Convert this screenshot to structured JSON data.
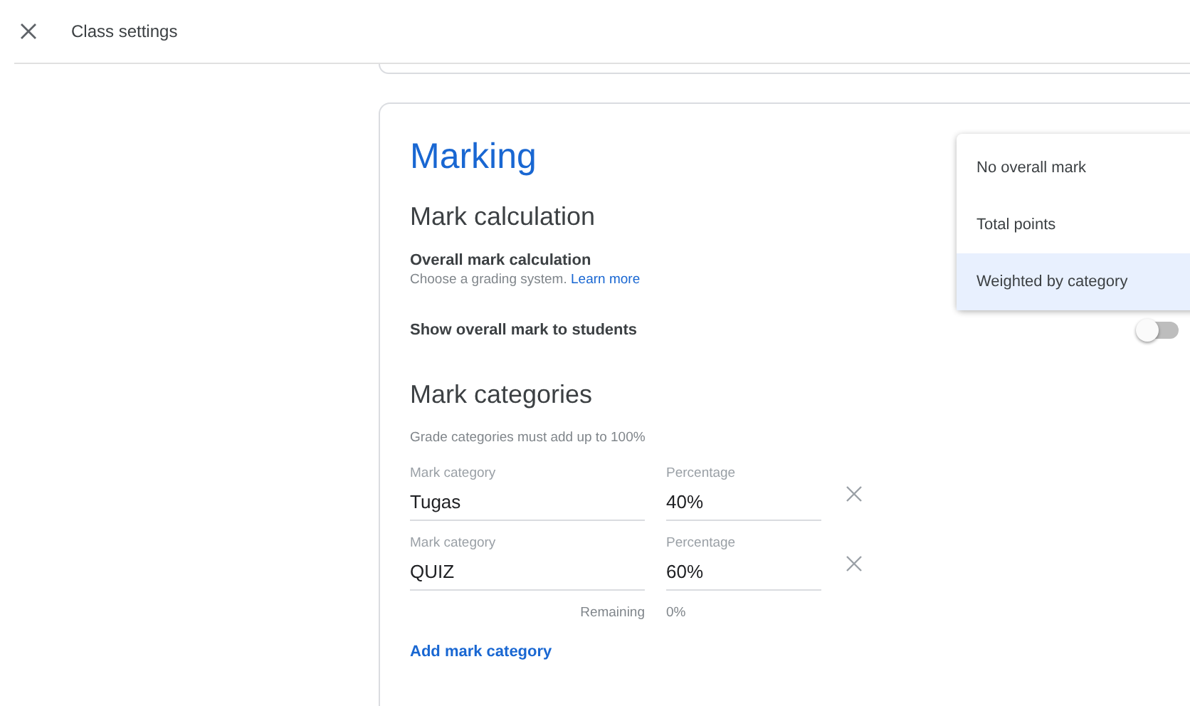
{
  "header": {
    "title": "Class settings"
  },
  "section": {
    "title": "Marking",
    "calculation": {
      "heading": "Mark calculation",
      "label": "Overall mark calculation",
      "hint": "Choose a grading system.",
      "link": "Learn more"
    },
    "show_to_students": {
      "label": "Show overall mark to students",
      "on": false
    },
    "categories": {
      "heading": "Mark categories",
      "hint": "Grade categories must add up to 100%",
      "rows": [
        {
          "name_label": "Mark category",
          "name": "Tugas",
          "percent_label": "Percentage",
          "percent": "40%"
        },
        {
          "name_label": "Mark category",
          "name": "QUIZ",
          "percent_label": "Percentage",
          "percent": "60%"
        }
      ],
      "remaining_label": "Remaining",
      "remaining": "0%",
      "add": "Add mark category"
    }
  },
  "dropdown": {
    "options": [
      {
        "label": "No overall mark",
        "selected": false
      },
      {
        "label": "Total points",
        "selected": false
      },
      {
        "label": "Weighted by category",
        "selected": true
      }
    ]
  }
}
